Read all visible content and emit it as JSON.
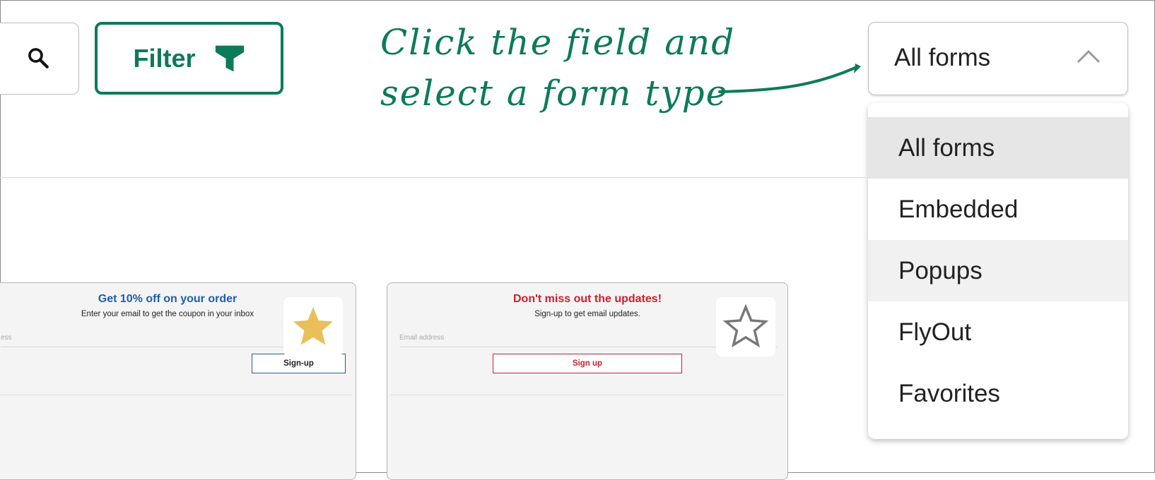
{
  "filter": {
    "label": "Filter"
  },
  "annotation": {
    "line1": "Click the field and",
    "line2": "select a form type"
  },
  "select": {
    "value": "All forms",
    "options": [
      "All forms",
      "Embedded",
      "Popups",
      "FlyOut",
      "Favorites"
    ],
    "selected_index": 0,
    "hovered_index": 2
  },
  "cards": [
    {
      "title": "Get 10% off on your order",
      "subtitle": "Enter your email to get the coupon in your inbox",
      "input_placeholder": "ess",
      "button_label": "Sign-up",
      "accent": "#1f5fa8",
      "favorite": true
    },
    {
      "title": "Don't miss out the updates!",
      "subtitle": "Sign-up to get email updates.",
      "input_placeholder": "Email address",
      "button_label": "Sign up",
      "accent": "#cc1f2e",
      "favorite": false
    }
  ],
  "colors": {
    "brand_green": "#0d7a5a",
    "star_filled": "#e9bf5a",
    "star_outline": "#777777"
  },
  "icons": {
    "search": "search-icon",
    "filter": "funnel-icon",
    "chevron": "chevron-up-icon",
    "star_filled": "star-filled-icon",
    "star_outline": "star-outline-icon"
  }
}
